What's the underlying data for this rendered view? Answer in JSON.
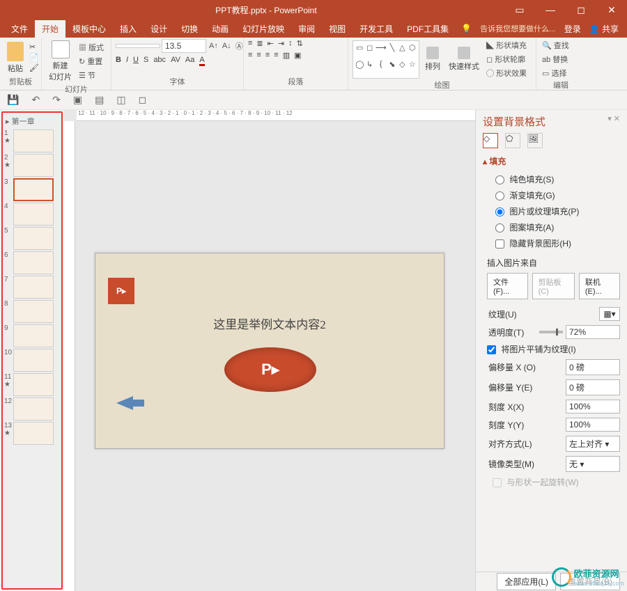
{
  "titlebar": {
    "title": "PPT教程.pptx - PowerPoint"
  },
  "menubar": {
    "tabs": [
      "文件",
      "开始",
      "模板中心",
      "插入",
      "设计",
      "切换",
      "动画",
      "幻灯片放映",
      "审阅",
      "视图",
      "开发工具",
      "PDF工具集"
    ],
    "active": 1,
    "tellme_icon": "💡",
    "tellme": "告诉我您想要做什么...",
    "login": "登录",
    "share": "共享"
  },
  "ribbon": {
    "clipboard": {
      "paste": "粘贴",
      "label": "剪贴板"
    },
    "slides": {
      "new": "新建\n幻灯片",
      "layout": "版式",
      "reset": "重置",
      "section": "节",
      "label": "幻灯片"
    },
    "font": {
      "name": "",
      "size": "13.5",
      "label": "字体"
    },
    "para": {
      "label": "段落"
    },
    "draw": {
      "arrange": "排列",
      "quick": "快速样式",
      "fill": "形状填充",
      "outline": "形状轮廓",
      "effect": "形状效果",
      "label": "绘图"
    },
    "edit": {
      "find": "查找",
      "replace": "替换",
      "select": "选择",
      "label": "编辑"
    }
  },
  "section_name": "第一章",
  "slide_selected": 3,
  "slide_count": 13,
  "slide_text": "这里是举例文本内容2",
  "pane": {
    "title": "设置背景格式",
    "fill": "填充",
    "solid": "纯色填充(S)",
    "gradient": "渐变填充(G)",
    "picture": "图片或纹理填充(P)",
    "pattern": "图案填充(A)",
    "hide": "隐藏背景图形(H)",
    "insert_from": "插入图片来自",
    "file": "文件(F)...",
    "clipboard": "剪贴板(C)",
    "online": "联机(E)...",
    "texture": "纹理(U)",
    "trans": "透明度(T)",
    "trans_val": "72%",
    "tile": "将图片平铺为纹理(I)",
    "offx": "偏移量 X (O)",
    "offx_v": "0 磅",
    "offy": "偏移量 Y(E)",
    "offy_v": "0 磅",
    "scx": "刻度 X(X)",
    "scx_v": "100%",
    "scy": "刻度 Y(Y)",
    "scy_v": "100%",
    "align": "对齐方式(L)",
    "align_v": "左上对齐",
    "mirror": "镜像类型(M)",
    "mirror_v": "无",
    "rotate": "与形状一起旋转(W)",
    "apply_all": "全部应用(L)",
    "reset": "重置背景(B)"
  },
  "watermark": {
    "name": "欧菲资源网",
    "url": "www.office26.com"
  }
}
